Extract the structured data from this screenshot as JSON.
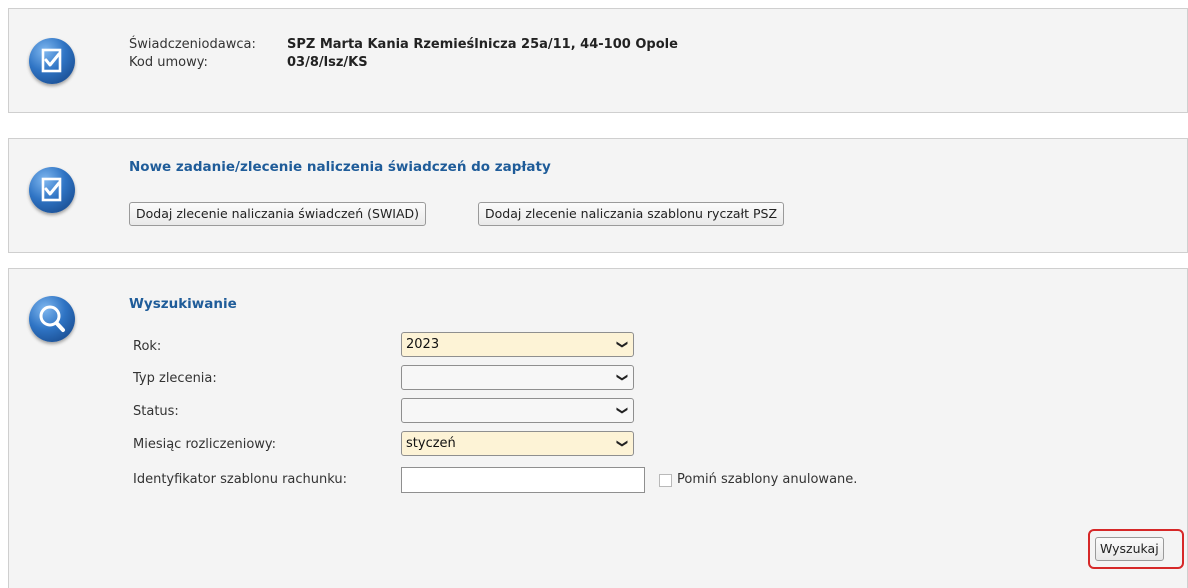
{
  "provider": {
    "label": "Świadczeniodawca:",
    "value": "SPZ Marta Kania Rzemieślnicza 25a/11, 44-100 Opole",
    "contract_label": "Kod umowy:",
    "contract_value": "03/8/lsz/KS"
  },
  "new_task": {
    "title": "Nowe zadanie/zlecenie naliczenia świadczeń do zapłaty",
    "btn_swiad": "Dodaj zlecenie naliczania świadczeń (SWIAD)",
    "btn_psz": "Dodaj zlecenie naliczania szablonu ryczałt PSZ"
  },
  "search": {
    "title": "Wyszukiwanie",
    "year_label": "Rok:",
    "year_value": "2023",
    "type_label": "Typ zlecenia:",
    "type_value": "",
    "status_label": "Status:",
    "status_value": "",
    "month_label": "Miesiąc rozliczeniowy:",
    "month_value": "styczeń",
    "template_id_label": "Identyfikator szablonu rachunku:",
    "template_id_value": "",
    "skip_cancelled_label": "Pomiń szablony anulowane.",
    "skip_cancelled_checked": false,
    "search_button": "Wyszukaj"
  },
  "colors": {
    "accent_title": "#1f5c99",
    "field_filled": "#fdf3d6",
    "highlight": "#d62828",
    "icon_blue": "#2f74c4"
  },
  "icons": {
    "edit_document": "document-check-icon",
    "search": "magnifier-icon",
    "dropdown": "chevron-down-icon"
  }
}
